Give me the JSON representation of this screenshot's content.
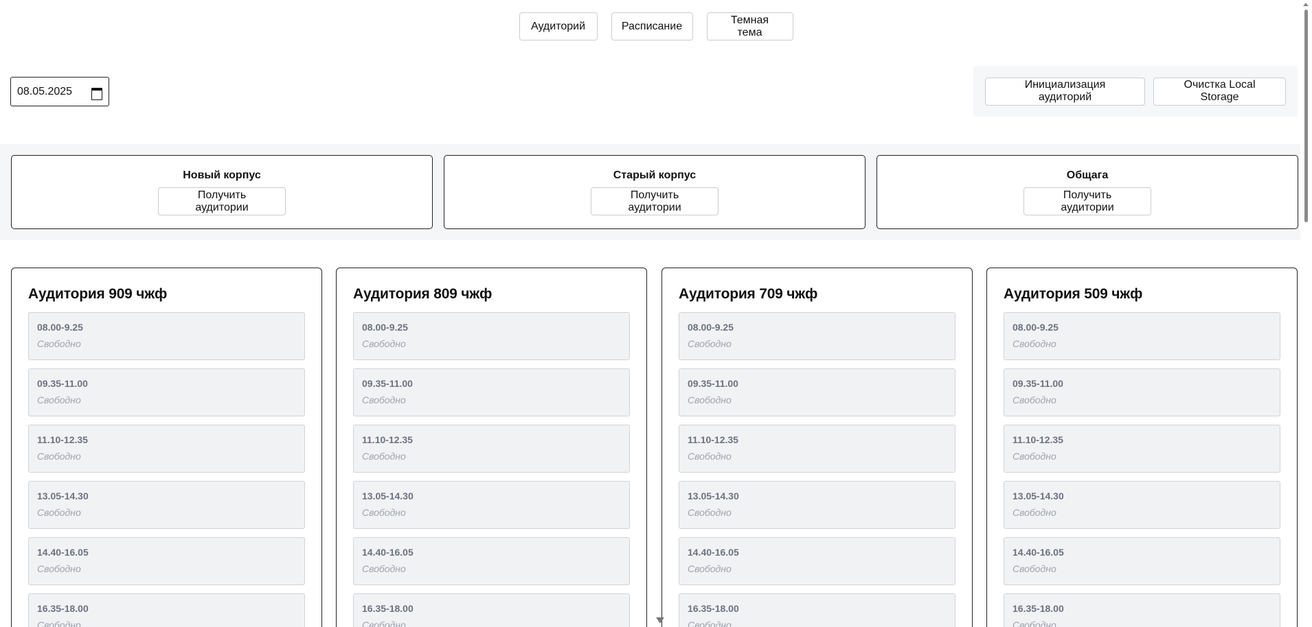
{
  "nav": {
    "items": [
      {
        "label": "Аудиторий"
      },
      {
        "label": "Расписание"
      },
      {
        "label": "Темная тема"
      }
    ]
  },
  "date": {
    "value": "08.05.2025"
  },
  "admin": {
    "init_label": "Инициализация аудиторий",
    "clear_label": "Очистка Local Storage"
  },
  "buildings": [
    {
      "title": "Новый корпус",
      "button_label": "Получить аудитории"
    },
    {
      "title": "Старый корпус",
      "button_label": "Получить аудитории"
    },
    {
      "title": "Общага",
      "button_label": "Получить аудитории"
    }
  ],
  "rooms": [
    {
      "title": "Аудитория 909 чжф",
      "slots": [
        {
          "time": "08.00-9.25",
          "status": "Свободно"
        },
        {
          "time": "09.35-11.00",
          "status": "Свободно"
        },
        {
          "time": "11.10-12.35",
          "status": "Свободно"
        },
        {
          "time": "13.05-14.30",
          "status": "Свободно"
        },
        {
          "time": "14.40-16.05",
          "status": "Свободно"
        },
        {
          "time": "16.35-18.00",
          "status": "Свободно"
        }
      ]
    },
    {
      "title": "Аудитория 809 чжф",
      "slots": [
        {
          "time": "08.00-9.25",
          "status": "Свободно"
        },
        {
          "time": "09.35-11.00",
          "status": "Свободно"
        },
        {
          "time": "11.10-12.35",
          "status": "Свободно"
        },
        {
          "time": "13.05-14.30",
          "status": "Свободно"
        },
        {
          "time": "14.40-16.05",
          "status": "Свободно"
        },
        {
          "time": "16.35-18.00",
          "status": "Свободно"
        }
      ]
    },
    {
      "title": "Аудитория 709 чжф",
      "slots": [
        {
          "time": "08.00-9.25",
          "status": "Свободно"
        },
        {
          "time": "09.35-11.00",
          "status": "Свободно"
        },
        {
          "time": "11.10-12.35",
          "status": "Свободно"
        },
        {
          "time": "13.05-14.30",
          "status": "Свободно"
        },
        {
          "time": "14.40-16.05",
          "status": "Свободно"
        },
        {
          "time": "16.35-18.00",
          "status": "Свободно"
        }
      ]
    },
    {
      "title": "Аудитория 509 чжф",
      "slots": [
        {
          "time": "08.00-9.25",
          "status": "Свободно"
        },
        {
          "time": "09.35-11.00",
          "status": "Свободно"
        },
        {
          "time": "11.10-12.35",
          "status": "Свободно"
        },
        {
          "time": "13.05-14.30",
          "status": "Свободно"
        },
        {
          "time": "14.40-16.05",
          "status": "Свободно"
        },
        {
          "time": "16.35-18.00",
          "status": "Свободно"
        }
      ]
    }
  ]
}
